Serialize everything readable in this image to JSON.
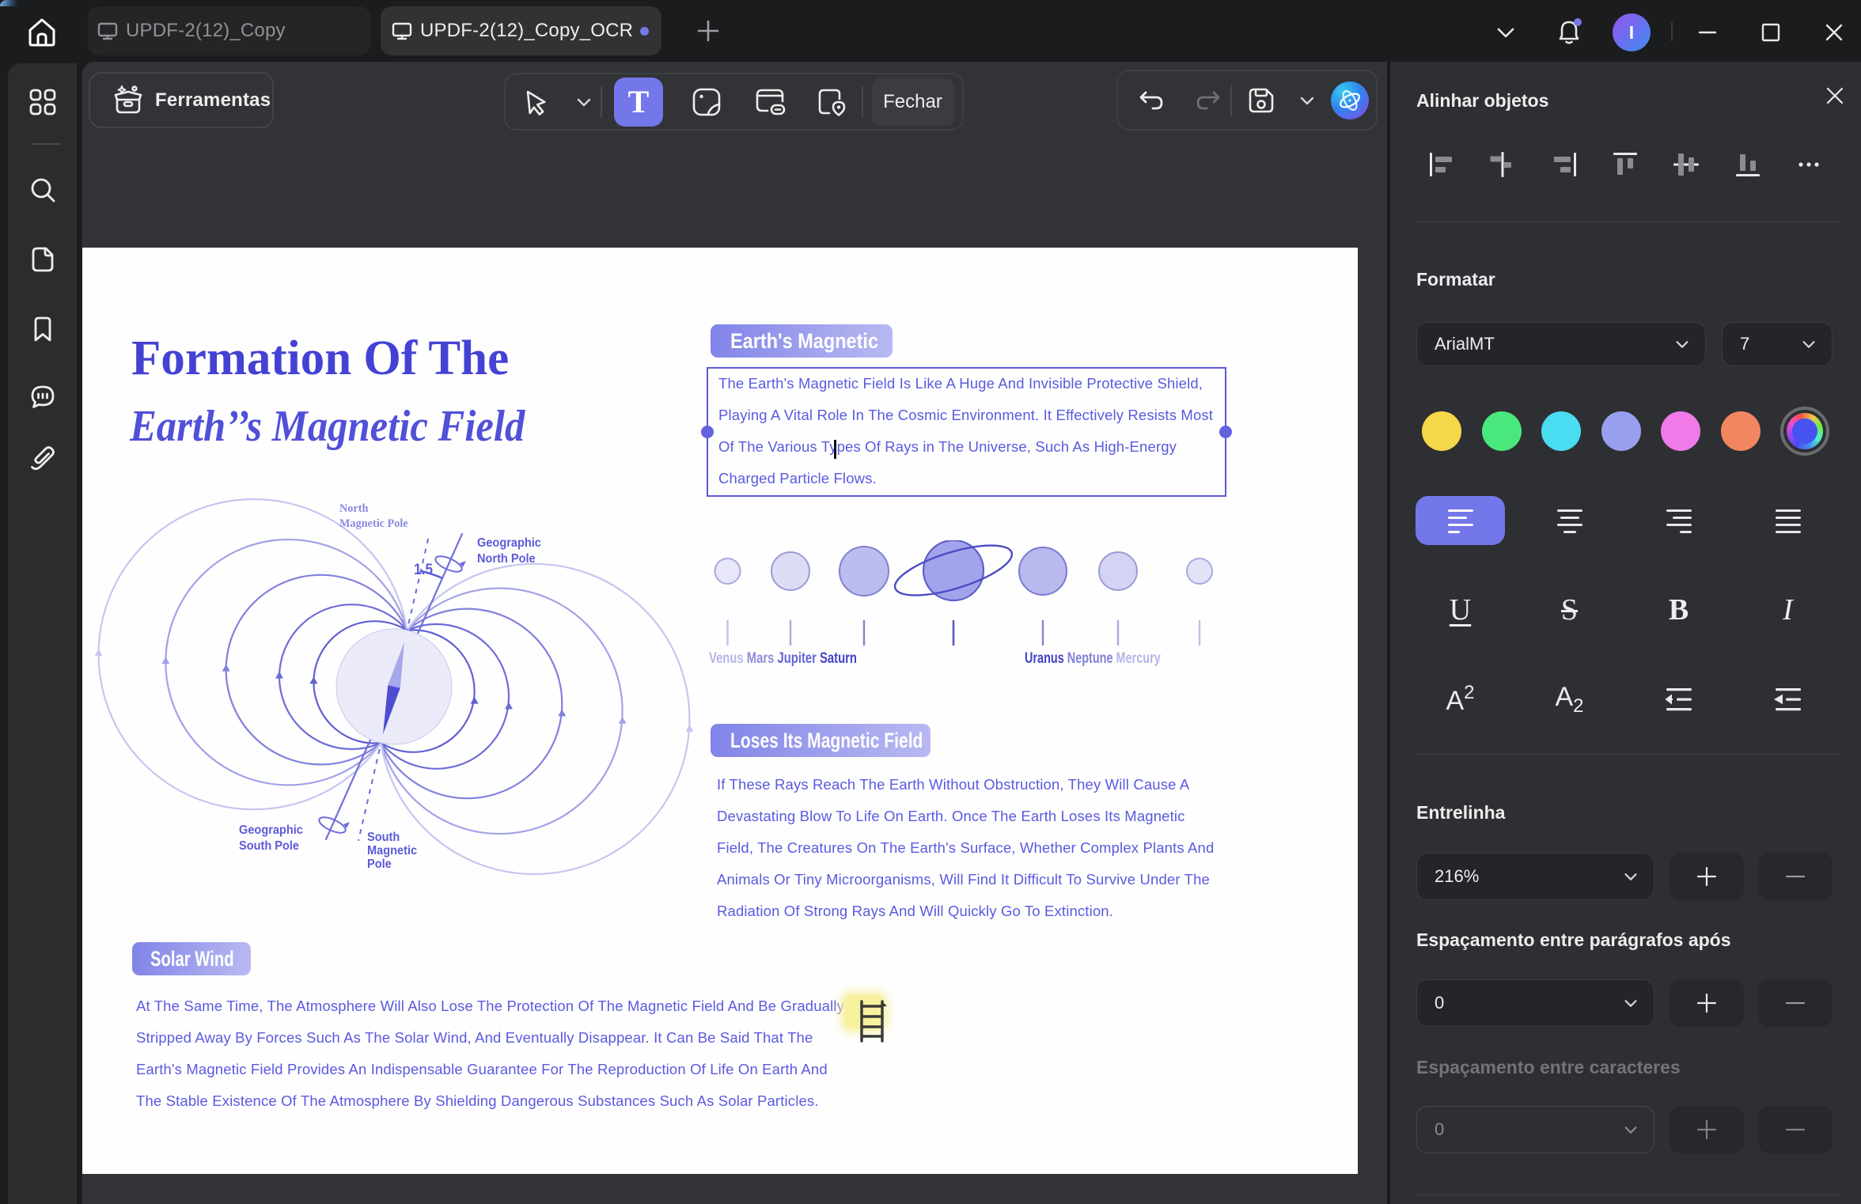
{
  "titlebar": {
    "tabs": [
      {
        "label": "UPDF-2(12)_Copy"
      },
      {
        "label": "UPDF-2(12)_Copy_OCR"
      }
    ],
    "avatar_initial": "I"
  },
  "toolbar": {
    "tools_label": "Ferramentas",
    "text_tool_glyph": "T",
    "close_label": "Fechar"
  },
  "right_panel": {
    "align_title": "Alinhar objetos",
    "format_title": "Formatar",
    "font_family": "ArialMT",
    "font_size": "7",
    "swatches": [
      "#f5d74a",
      "#4ae87c",
      "#4adcf0",
      "#989fee",
      "#f07ae8",
      "#f28661"
    ],
    "accent": "#7477ea",
    "underline_glyph": "U",
    "strike_glyph": "S",
    "bold_glyph": "B",
    "italic_glyph": "I",
    "superscript_base": "A",
    "superscript_exp": "2",
    "subscript_base": "A",
    "subscript_exp": "2",
    "line_spacing_label": "Entrelinha",
    "line_spacing_value": "216%",
    "para_after_label": "Espaçamento entre parágrafos após",
    "para_after_value": "0",
    "char_spacing_label": "Espaçamento entre caracteres",
    "char_spacing_value": "0"
  },
  "document": {
    "title_line1": "Formation Of The",
    "title_line2": "Earth’’s Magnetic Field",
    "section1_badge": "Earth's Magnetic",
    "section1_text": "The Earth's Magnetic Field Is Like A Huge And Invisible Protective Shield,\nPlaying A Vital Role In The Cosmic Environment. It Effectively Resists Most\nOf The Various Types Of Rays in The Universe, Such As High-Energy\nCharged Particle Flows.",
    "section2_badge": "Loses Its Magnetic Field",
    "section2_text": "If These Rays Reach The Earth Without Obstruction, They Will Cause A\nDevastating Blow To Life On Earth. Once The Earth Loses Its Magnetic\nField, The Creatures On The Earth's Surface, Whether Complex Plants And\nAnimals Or Tiny Microorganisms, Will Find It Difficult To Survive Under The\nRadiation Of Strong Rays And Will Quickly Go To Extinction.",
    "section3_badge": "Solar Wind",
    "section3_text": "At The Same Time, The Atmosphere Will Also Lose The Protection Of The Magnetic Field And Be Gradually\nStripped Away By Forces Such As The Solar Wind, And Eventually Disappear. It Can Be Said That The\nEarth's Magnetic Field Provides An Indispensable Guarantee For The Reproduction Of Life On Earth And\nThe Stable Existence Of The Atmosphere By Shielding Dangerous Substances Such As Solar Particles.",
    "diagram": {
      "north_magnetic": "North\nMagnetic Pole",
      "geo_north": "Geographic\nNorth Pole",
      "geo_south": "Geographic\nSouth Pole",
      "south_magnetic": "South\nMagnetic\nPole",
      "angle": "1.5"
    },
    "planets": {
      "left": [
        {
          "label": "Venus",
          "color": "#b6b6e8"
        },
        {
          "label": "Mars",
          "color": "#8f8fdc"
        },
        {
          "label": "Jupiter",
          "color": "#6464d4"
        },
        {
          "label": "Saturn",
          "color": "#4343c6"
        }
      ],
      "right": [
        {
          "label": "Uranus",
          "color": "#4343c6"
        },
        {
          "label": "Neptune",
          "color": "#8080d8"
        },
        {
          "label": "Mercury",
          "color": "#b6b6e8"
        }
      ]
    }
  }
}
